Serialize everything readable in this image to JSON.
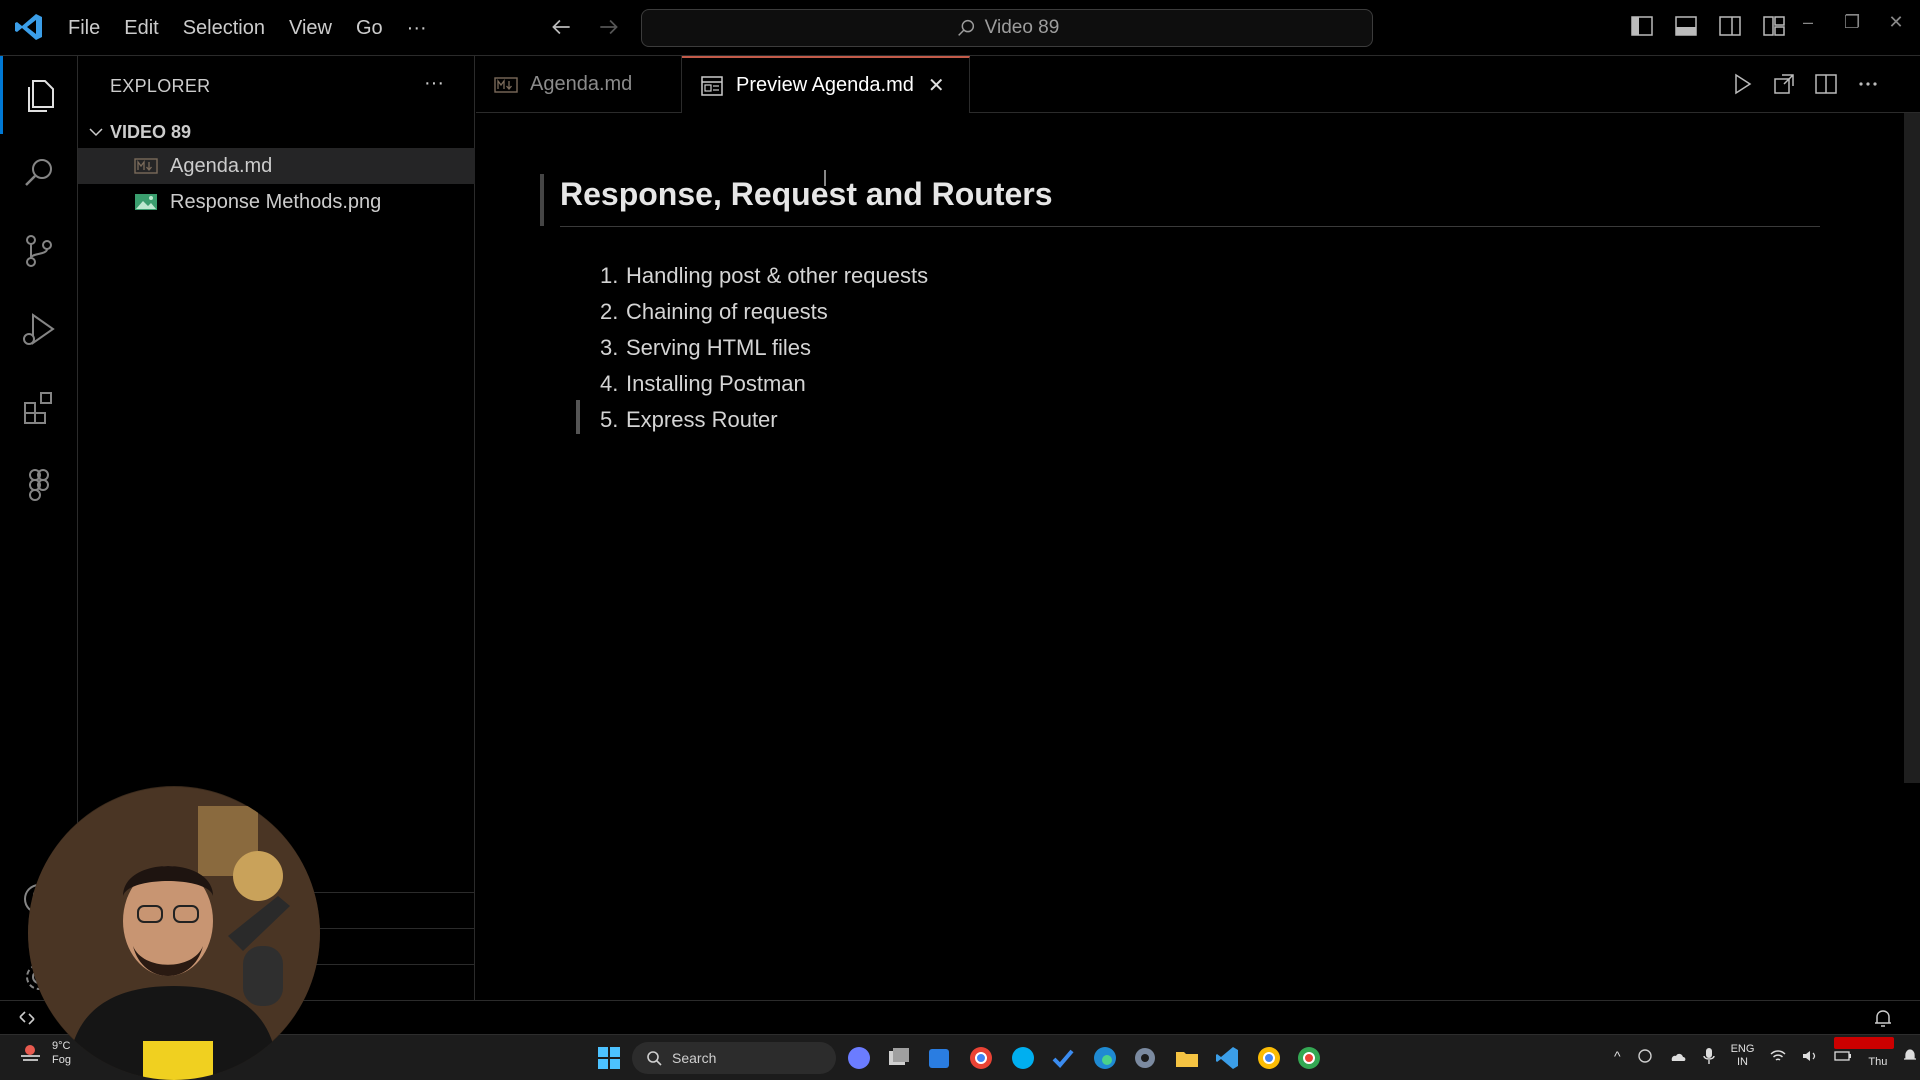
{
  "menu": {
    "items": [
      "File",
      "Edit",
      "Selection",
      "View",
      "Go"
    ],
    "more": "···"
  },
  "command_center": {
    "text": "Video 89"
  },
  "explorer": {
    "title": "EXPLORER",
    "more": "···",
    "folder": "VIDEO 89",
    "files": [
      {
        "name": "Agenda.md",
        "icon": "markdown-icon",
        "selected": true
      },
      {
        "name": "Response Methods.png",
        "icon": "image-icon",
        "selected": false
      }
    ]
  },
  "tabs": [
    {
      "label": "Agenda.md",
      "icon": "markdown-icon",
      "active": false
    },
    {
      "label": "Preview Agenda.md",
      "icon": "preview-icon",
      "active": true,
      "close": "✕"
    }
  ],
  "preview": {
    "heading": "Response, Request and Routers",
    "items": [
      {
        "num": "1.",
        "text": "Handling post & other requests"
      },
      {
        "num": "2.",
        "text": "Chaining of requests"
      },
      {
        "num": "3.",
        "text": "Serving HTML files"
      },
      {
        "num": "4.",
        "text": "Installing Postman"
      },
      {
        "num": "5.",
        "text": "Express Router"
      }
    ]
  },
  "taskbar": {
    "weather_temp": "9°C",
    "weather_desc": "Fog",
    "search_label": "Search",
    "lang_top": "ENG",
    "lang_bottom": "IN",
    "clock_day": "Thu"
  },
  "colors": {
    "accent": "#0078d4",
    "active_tab_border": "#c35b4a",
    "background": "#000000"
  }
}
